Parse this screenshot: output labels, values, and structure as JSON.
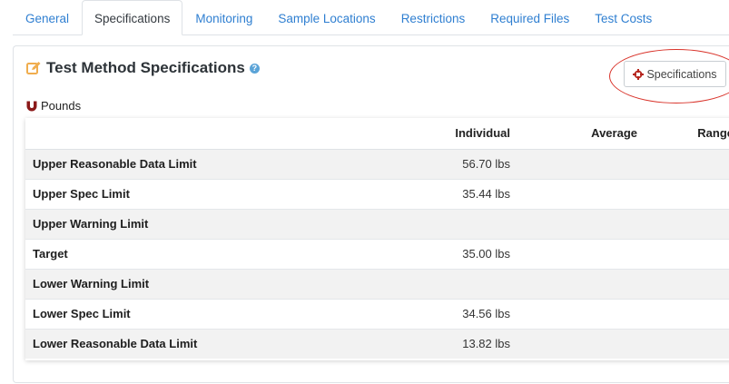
{
  "tabs": [
    {
      "label": "General",
      "active": false
    },
    {
      "label": "Specifications",
      "active": true
    },
    {
      "label": "Monitoring",
      "active": false
    },
    {
      "label": "Sample Locations",
      "active": false
    },
    {
      "label": "Restrictions",
      "active": false
    },
    {
      "label": "Required Files",
      "active": false
    },
    {
      "label": "Test Costs",
      "active": false
    }
  ],
  "card": {
    "title": "Test Method Specifications",
    "help_icon": "?",
    "specifications_button": "Specifications",
    "unit_label": "Pounds"
  },
  "table": {
    "headers": [
      "",
      "Individual",
      "Average",
      "Range"
    ],
    "rows": [
      {
        "name": "Upper Reasonable Data Limit",
        "individual": "56.70 lbs",
        "average": "",
        "range": ""
      },
      {
        "name": "Upper Spec Limit",
        "individual": "35.44 lbs",
        "average": "",
        "range": ""
      },
      {
        "name": "Upper Warning Limit",
        "individual": "",
        "average": "",
        "range": ""
      },
      {
        "name": "Target",
        "individual": "35.00 lbs",
        "average": "",
        "range": ""
      },
      {
        "name": "Lower Warning Limit",
        "individual": "",
        "average": "",
        "range": ""
      },
      {
        "name": "Lower Spec Limit",
        "individual": "34.56 lbs",
        "average": "",
        "range": ""
      },
      {
        "name": "Lower Reasonable Data Limit",
        "individual": "13.82 lbs",
        "average": "",
        "range": ""
      }
    ]
  },
  "colors": {
    "link": "#2f7fd1",
    "edit_icon": "#f0ad4e",
    "help_icon": "#5ba4d8",
    "magnet_icon": "#8b1a1a",
    "crosshair_icon": "#b5241c",
    "highlight_ellipse": "#d9342b"
  }
}
